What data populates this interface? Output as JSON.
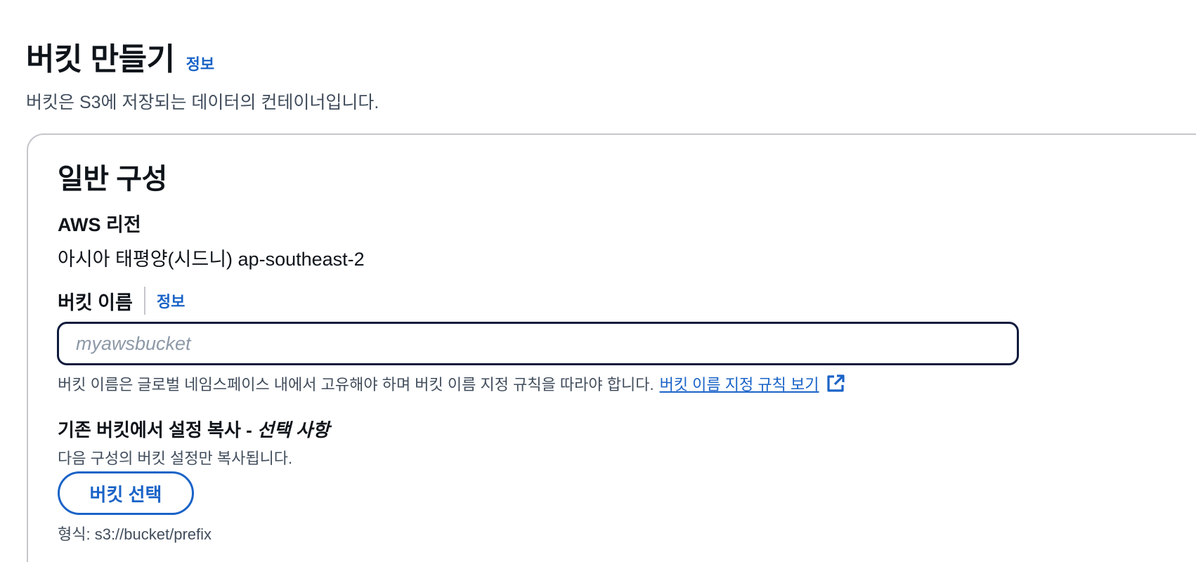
{
  "header": {
    "title": "버킷 만들기",
    "info_link": "정보",
    "subtitle": "버킷은 S3에 저장되는 데이터의 컨테이너입니다."
  },
  "general_config": {
    "section_title": "일반 구성",
    "region": {
      "label": "AWS 리전",
      "value": "아시아 태평양(시드니) ap-southeast-2"
    },
    "bucket_name": {
      "label": "버킷 이름",
      "info_link": "정보",
      "value": "",
      "placeholder": "myawsbucket",
      "hint": "버킷 이름은 글로벌 네임스페이스 내에서 고유해야 하며 버킷 이름 지정 규칙을 따라야 합니다.",
      "rules_link": "버킷 이름 지정 규칙 보기",
      "rules_link_icon": "external-link-icon"
    },
    "copy_settings": {
      "label": "기존 버킷에서 설정 복사 - ",
      "optional": "선택 사항",
      "description": "다음 구성의 버킷 설정만 복사됩니다.",
      "button_label": "버킷 선택",
      "format": "형식: s3://bucket/prefix"
    }
  },
  "colors": {
    "link": "#1a63c7",
    "input_border_focus": "#0f1b3d",
    "card_border": "#c6c6cd",
    "secondary_text": "#414d5c"
  }
}
